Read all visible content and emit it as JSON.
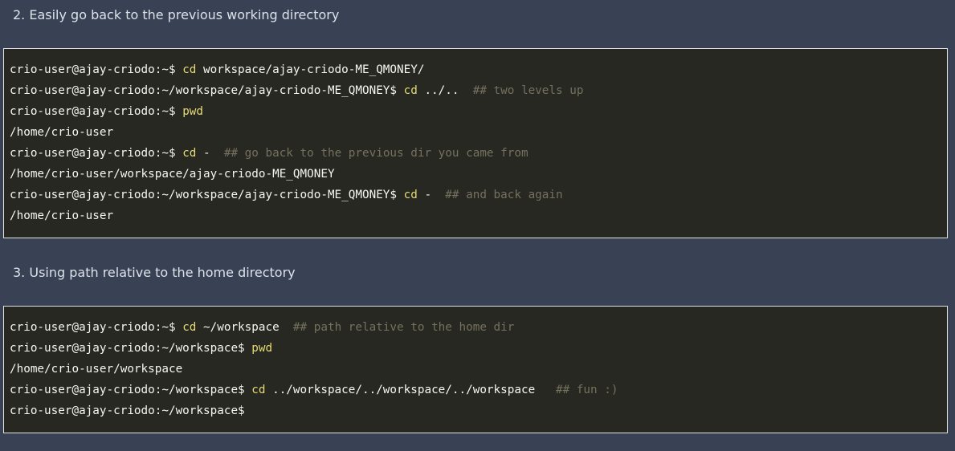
{
  "sections": [
    {
      "heading": "2. Easily go back to the previous working directory",
      "lines": [
        [
          {
            "t": "crio-user@ajay-criodo:~$ ",
            "c": "p"
          },
          {
            "t": "cd",
            "c": "kw"
          },
          {
            "t": " workspace/ajay-criodo-ME_QMONEY/",
            "c": "p"
          }
        ],
        [
          {
            "t": "crio-user@ajay-criodo:~/workspace/ajay-criodo-ME_QMONEY$ ",
            "c": "p"
          },
          {
            "t": "cd",
            "c": "kw"
          },
          {
            "t": " ../..  ",
            "c": "p"
          },
          {
            "t": "## two levels up",
            "c": "cm"
          }
        ],
        [
          {
            "t": "crio-user@ajay-criodo:~$ ",
            "c": "p"
          },
          {
            "t": "pwd",
            "c": "kw"
          }
        ],
        [
          {
            "t": "/home/crio-user",
            "c": "p"
          }
        ],
        [
          {
            "t": "crio-user@ajay-criodo:~$ ",
            "c": "p"
          },
          {
            "t": "cd",
            "c": "kw"
          },
          {
            "t": " -  ",
            "c": "p"
          },
          {
            "t": "## go back to the previous dir you came from",
            "c": "cm"
          }
        ],
        [
          {
            "t": "/home/crio-user/workspace/ajay-criodo-ME_QMONEY",
            "c": "p"
          }
        ],
        [
          {
            "t": "crio-user@ajay-criodo:~/workspace/ajay-criodo-ME_QMONEY$ ",
            "c": "p"
          },
          {
            "t": "cd",
            "c": "kw"
          },
          {
            "t": " -  ",
            "c": "p"
          },
          {
            "t": "## and back again",
            "c": "cm"
          }
        ],
        [
          {
            "t": "/home/crio-user",
            "c": "p"
          }
        ]
      ]
    },
    {
      "heading": "3. Using path relative to the home directory",
      "lines": [
        [
          {
            "t": "crio-user@ajay-criodo:~$ ",
            "c": "p"
          },
          {
            "t": "cd",
            "c": "kw"
          },
          {
            "t": " ~/workspace  ",
            "c": "p"
          },
          {
            "t": "## path relative to the home dir",
            "c": "cm"
          }
        ],
        [
          {
            "t": "crio-user@ajay-criodo:~/workspace$ ",
            "c": "p"
          },
          {
            "t": "pwd",
            "c": "kw"
          }
        ],
        [
          {
            "t": "/home/crio-user/workspace",
            "c": "p"
          }
        ],
        [
          {
            "t": "crio-user@ajay-criodo:~/workspace$ ",
            "c": "p"
          },
          {
            "t": "cd",
            "c": "kw"
          },
          {
            "t": " ../workspace/../workspace/../workspace   ",
            "c": "p"
          },
          {
            "t": "## fun :)",
            "c": "cm"
          }
        ],
        [
          {
            "t": "crio-user@ajay-criodo:~/workspace$",
            "c": "p"
          }
        ]
      ]
    }
  ],
  "colors": {
    "page_background": "#384254",
    "code_background": "#272822",
    "code_text": "#f6f6f0",
    "keyword": "#e6db74",
    "comment": "#75715e"
  }
}
